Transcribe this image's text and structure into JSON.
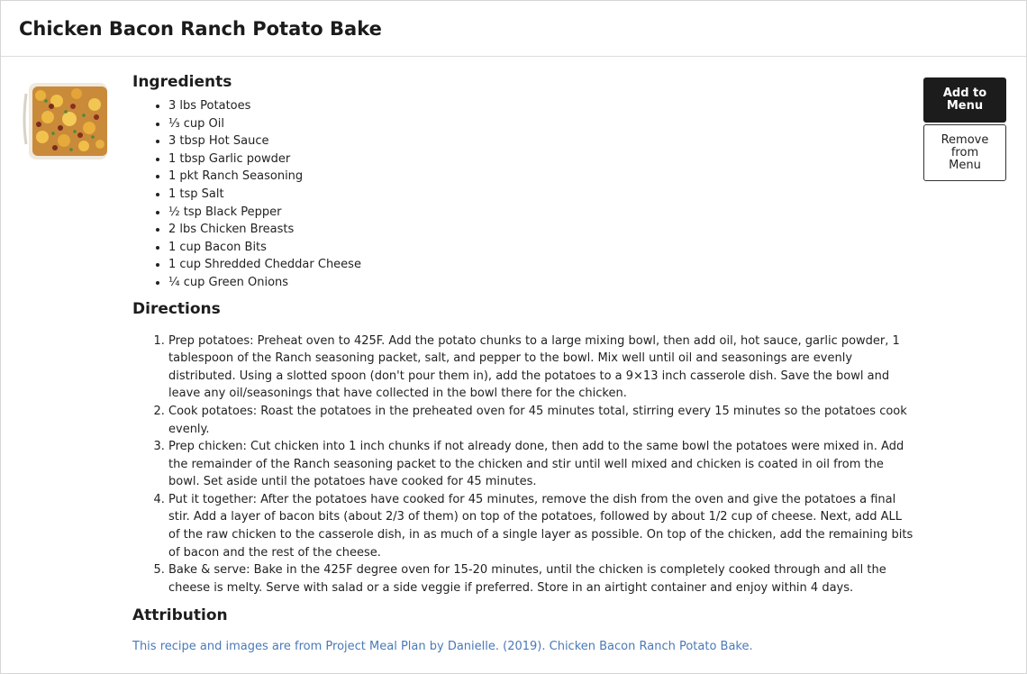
{
  "recipe": {
    "title": "Chicken Bacon Ranch Potato Bake",
    "ingredients_heading": "Ingredients",
    "ingredients": [
      "3 lbs Potatoes",
      "⅓ cup Oil",
      "3 tbsp Hot Sauce",
      "1 tbsp Garlic powder",
      "1 pkt Ranch Seasoning",
      "1 tsp Salt",
      "½ tsp Black Pepper",
      "2 lbs Chicken Breasts",
      "1 cup Bacon Bits",
      "1 cup Shredded Cheddar Cheese",
      "¼ cup Green Onions"
    ],
    "directions_heading": "Directions",
    "directions": [
      "Prep potatoes: Preheat oven to 425F. Add the potato chunks to a large mixing bowl, then add oil, hot sauce, garlic powder, 1 tablespoon of the Ranch seasoning packet, salt, and pepper to the bowl. Mix well until oil and seasonings are evenly distributed. Using a slotted spoon (don't pour them in), add the potatoes to a 9×13 inch casserole dish. Save the bowl and leave any oil/seasonings that have collected in the bowl there for the chicken.",
      "Cook potatoes: Roast the potatoes in the preheated oven for 45 minutes total, stirring every 15 minutes so the potatoes cook evenly.",
      "Prep chicken: Cut chicken into 1 inch chunks if not already done, then add to the same bowl the potatoes were mixed in. Add the remainder of the Ranch seasoning packet to the chicken and stir until well mixed and chicken is coated in oil from the bowl. Set aside until the potatoes have cooked for 45 minutes.",
      "Put it together: After the potatoes have cooked for 45 minutes, remove the dish from the oven and give the potatoes a final stir. Add a layer of bacon bits (about 2/3 of them) on top of the potatoes, followed by about 1/2 cup of cheese. Next, add ALL of the raw chicken to the casserole dish, in as much of a single layer as possible. On top of the chicken, add the remaining bits of bacon and the rest of the cheese.",
      "Bake & serve: Bake in the 425F degree oven for 15-20 minutes, until the chicken is completely cooked through and all the cheese is melty. Serve with salad or a side veggie if preferred. Store in an airtight container and enjoy within 4 days."
    ],
    "attribution_heading": "Attribution",
    "attribution_text": "This recipe and images are from Project Meal Plan by Danielle. (2019). Chicken Bacon Ranch Potato Bake."
  },
  "actions": {
    "add_label": "Add to Menu",
    "remove_label": "Remove from Menu"
  },
  "colors": {
    "primary_button": "#1c1c1c",
    "link": "#4a79b8"
  }
}
